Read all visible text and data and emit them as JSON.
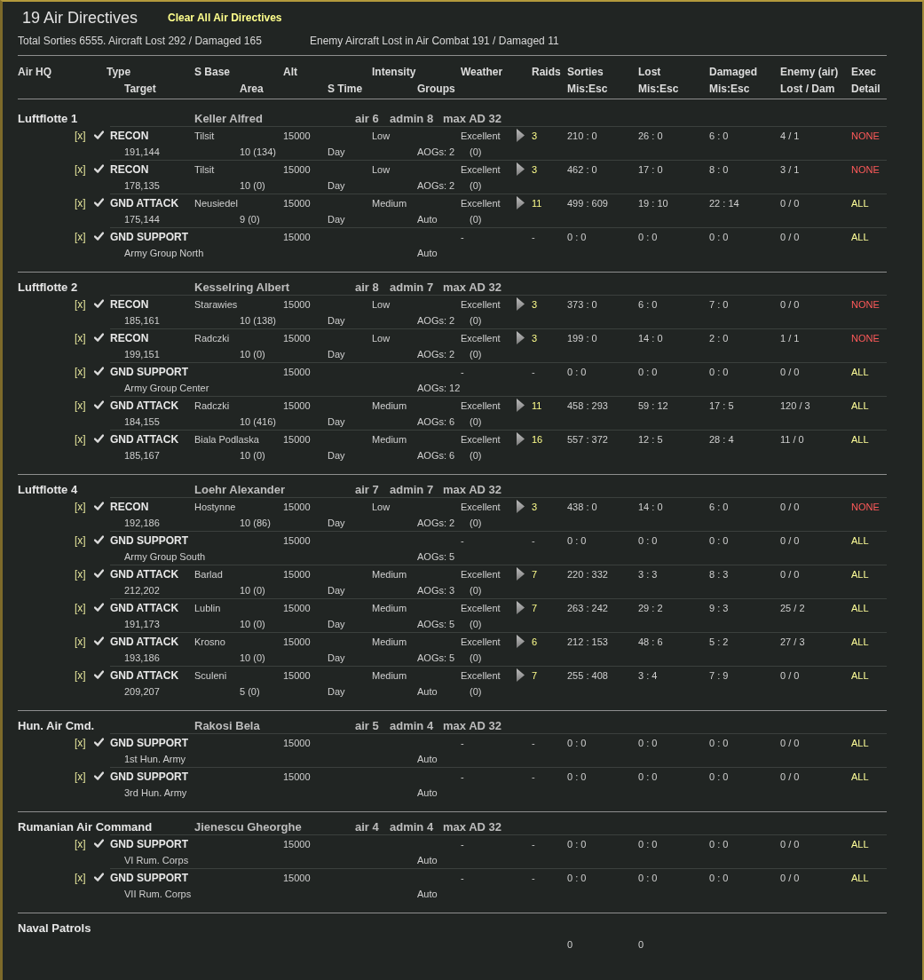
{
  "window": {
    "title": "19 Air Directives",
    "action": "Clear All Air Directives"
  },
  "summary": {
    "own": "Total Sorties 6555. Aircraft Lost 292 / Damaged 165",
    "enemy": "Enemy Aircraft Lost in Air Combat 191 / Damaged 11"
  },
  "table": {
    "header_top": [
      "Air HQ",
      "Type",
      "S Base",
      "Alt",
      "Intensity",
      "Weather",
      "Raids",
      "Sorties",
      "Lost",
      "Damaged",
      "Enemy (air)",
      "Exec"
    ],
    "header_bottom": [
      "Target",
      "Area",
      "S Time",
      "Groups",
      "Mis:Esc",
      "Mis:Esc",
      "Mis:Esc",
      "Lost / Dam",
      "Detail"
    ],
    "groups": [
      {
        "name": "Luftflotte 1",
        "commander": "Keller Alfred",
        "air": "air 6",
        "admin": "admin 8",
        "max_ad": "max AD 32",
        "directives": [
          {
            "delete": "[x]",
            "checked": true,
            "type": "RECON",
            "base": "Tilsit",
            "alt": "15000",
            "intensity": "Low",
            "weather": "Excellent",
            "expandable": true,
            "raids": "3",
            "sorties": "210 : 0",
            "lost": "26 : 0",
            "damaged": "6 : 0",
            "enemy": "4 / 1",
            "exec": {
              "text": "NONE",
              "color": "#ff5a5a"
            },
            "target": "191,144",
            "area": "10 (134)",
            "time": "Day",
            "groups": "AOGs: 2",
            "note": "(0)"
          },
          {
            "delete": "[x]",
            "checked": true,
            "type": "RECON",
            "base": "Tilsit",
            "alt": "15000",
            "intensity": "Low",
            "weather": "Excellent",
            "expandable": true,
            "raids": "3",
            "sorties": "462 : 0",
            "lost": "17 : 0",
            "damaged": "8 : 0",
            "enemy": "3 / 1",
            "exec": {
              "text": "NONE",
              "color": "#ff5a5a"
            },
            "target": "178,135",
            "area": "10 (0)",
            "time": "Day",
            "groups": "AOGs: 2",
            "note": "(0)"
          },
          {
            "delete": "[x]",
            "checked": true,
            "type": "GND ATTACK",
            "base": "Neusiedel",
            "alt": "15000",
            "intensity": "Medium",
            "weather": "Excellent",
            "expandable": true,
            "raids": "11",
            "sorties": "499 : 609",
            "lost": "19 : 10",
            "damaged": "22 : 14",
            "enemy": "0 / 0",
            "exec": {
              "text": "ALL",
              "color": "#ffff99"
            },
            "target": "175,144",
            "area": "9 (0)",
            "time": "Day",
            "groups": "Auto",
            "note": "(0)"
          },
          {
            "delete": "[x]",
            "checked": true,
            "type": "GND SUPPORT",
            "alt": "15000",
            "weather": "-",
            "expandable": false,
            "raids": "-",
            "sorties": "0 : 0",
            "lost": "0 : 0",
            "damaged": "0 : 0",
            "enemy": "0 / 0",
            "exec": {
              "text": "ALL",
              "color": "#ffff99"
            },
            "target": "Army Group North",
            "groups": "Auto"
          }
        ]
      },
      {
        "name": "Luftflotte 2",
        "commander": "Kesselring Albert",
        "air": "air 8",
        "admin": "admin 7",
        "max_ad": "max AD 32",
        "directives": [
          {
            "delete": "[x]",
            "checked": true,
            "type": "RECON",
            "base": "Starawies",
            "alt": "15000",
            "intensity": "Low",
            "weather": "Excellent",
            "expandable": true,
            "raids": "3",
            "sorties": "373 : 0",
            "lost": "6 : 0",
            "damaged": "7 : 0",
            "enemy": "0 / 0",
            "exec": {
              "text": "NONE",
              "color": "#ff5a5a"
            },
            "target": "185,161",
            "area": "10 (138)",
            "time": "Day",
            "groups": "AOGs: 2",
            "note": "(0)"
          },
          {
            "delete": "[x]",
            "checked": true,
            "type": "RECON",
            "base": "Radczki",
            "alt": "15000",
            "intensity": "Low",
            "weather": "Excellent",
            "expandable": true,
            "raids": "3",
            "sorties": "199 : 0",
            "lost": "14 : 0",
            "damaged": "2 : 0",
            "enemy": "1 / 1",
            "exec": {
              "text": "NONE",
              "color": "#ff5a5a"
            },
            "target": "199,151",
            "area": "10 (0)",
            "time": "Day",
            "groups": "AOGs: 2",
            "note": "(0)"
          },
          {
            "delete": "[x]",
            "checked": true,
            "type": "GND SUPPORT",
            "alt": "15000",
            "weather": "-",
            "expandable": false,
            "raids": "-",
            "sorties": "0 : 0",
            "lost": "0 : 0",
            "damaged": "0 : 0",
            "enemy": "0 / 0",
            "exec": {
              "text": "ALL",
              "color": "#ffff99"
            },
            "target": "Army Group Center",
            "groups": "AOGs: 12"
          },
          {
            "delete": "[x]",
            "checked": true,
            "type": "GND ATTACK",
            "base": "Radczki",
            "alt": "15000",
            "intensity": "Medium",
            "weather": "Excellent",
            "expandable": true,
            "raids": "11",
            "sorties": "458 : 293",
            "lost": "59 : 12",
            "damaged": "17 : 5",
            "enemy": "120 / 3",
            "exec": {
              "text": "ALL",
              "color": "#ffff99"
            },
            "target": "184,155",
            "area": "10 (416)",
            "time": "Day",
            "groups": "AOGs: 6",
            "note": "(0)"
          },
          {
            "delete": "[x]",
            "checked": true,
            "type": "GND ATTACK",
            "base": "Biala Podlaska",
            "alt": "15000",
            "intensity": "Medium",
            "weather": "Excellent",
            "expandable": true,
            "raids": "16",
            "sorties": "557 : 372",
            "lost": "12 : 5",
            "damaged": "28 : 4",
            "enemy": "11 / 0",
            "exec": {
              "text": "ALL",
              "color": "#ffff99"
            },
            "target": "185,167",
            "area": "10 (0)",
            "time": "Day",
            "groups": "AOGs: 6",
            "note": "(0)"
          }
        ]
      },
      {
        "name": "Luftflotte 4",
        "commander": "Loehr Alexander",
        "air": "air 7",
        "admin": "admin 7",
        "max_ad": "max AD 32",
        "directives": [
          {
            "delete": "[x]",
            "checked": true,
            "type": "RECON",
            "base": "Hostynne",
            "alt": "15000",
            "intensity": "Low",
            "weather": "Excellent",
            "expandable": true,
            "raids": "3",
            "sorties": "438 : 0",
            "lost": "14 : 0",
            "damaged": "6 : 0",
            "enemy": "0 / 0",
            "exec": {
              "text": "NONE",
              "color": "#ff5a5a"
            },
            "target": "192,186",
            "area": "10 (86)",
            "time": "Day",
            "groups": "AOGs: 2",
            "note": "(0)"
          },
          {
            "delete": "[x]",
            "checked": true,
            "type": "GND SUPPORT",
            "alt": "15000",
            "weather": "-",
            "expandable": false,
            "raids": "-",
            "sorties": "0 : 0",
            "lost": "0 : 0",
            "damaged": "0 : 0",
            "enemy": "0 / 0",
            "exec": {
              "text": "ALL",
              "color": "#ffff99"
            },
            "target": "Army Group South",
            "groups": "AOGs: 5"
          },
          {
            "delete": "[x]",
            "checked": true,
            "type": "GND ATTACK",
            "base": "Barlad",
            "alt": "15000",
            "intensity": "Medium",
            "weather": "Excellent",
            "expandable": true,
            "raids": "7",
            "sorties": "220 : 332",
            "lost": "3 : 3",
            "damaged": "8 : 3",
            "enemy": "0 / 0",
            "exec": {
              "text": "ALL",
              "color": "#ffff99"
            },
            "target": "212,202",
            "area": "10 (0)",
            "time": "Day",
            "groups": "AOGs: 3",
            "note": "(0)"
          },
          {
            "delete": "[x]",
            "checked": true,
            "type": "GND ATTACK",
            "base": "Lublin",
            "alt": "15000",
            "intensity": "Medium",
            "weather": "Excellent",
            "expandable": true,
            "raids": "7",
            "sorties": "263 : 242",
            "lost": "29 : 2",
            "damaged": "9 : 3",
            "enemy": "25 / 2",
            "exec": {
              "text": "ALL",
              "color": "#ffff99"
            },
            "target": "191,173",
            "area": "10 (0)",
            "time": "Day",
            "groups": "AOGs: 5",
            "note": "(0)"
          },
          {
            "delete": "[x]",
            "checked": true,
            "type": "GND ATTACK",
            "base": "Krosno",
            "alt": "15000",
            "intensity": "Medium",
            "weather": "Excellent",
            "expandable": true,
            "raids": "6",
            "sorties": "212 : 153",
            "lost": "48 : 6",
            "damaged": "5 : 2",
            "enemy": "27 / 3",
            "exec": {
              "text": "ALL",
              "color": "#ffff99"
            },
            "target": "193,186",
            "area": "10 (0)",
            "time": "Day",
            "groups": "AOGs: 5",
            "note": "(0)"
          },
          {
            "delete": "[x]",
            "checked": true,
            "type": "GND ATTACK",
            "base": "Sculeni",
            "alt": "15000",
            "intensity": "Medium",
            "weather": "Excellent",
            "expandable": true,
            "raids": "7",
            "sorties": "255 : 408",
            "lost": "3 : 4",
            "damaged": "7 : 9",
            "enemy": "0 / 0",
            "exec": {
              "text": "ALL",
              "color": "#ffff99"
            },
            "target": "209,207",
            "area": "5 (0)",
            "time": "Day",
            "groups": "Auto",
            "note": "(0)"
          }
        ]
      },
      {
        "name": "Hun. Air Cmd.",
        "commander": "Rakosi Bela",
        "air": "air 5",
        "admin": "admin 4",
        "max_ad": "max AD 32",
        "directives": [
          {
            "delete": "[x]",
            "checked": true,
            "type": "GND SUPPORT",
            "alt": "15000",
            "weather": "-",
            "expandable": false,
            "raids": "-",
            "sorties": "0 : 0",
            "lost": "0 : 0",
            "damaged": "0 : 0",
            "enemy": "0 / 0",
            "exec": {
              "text": "ALL",
              "color": "#ffff99"
            },
            "target": "1st Hun. Army",
            "groups": "Auto"
          },
          {
            "delete": "[x]",
            "checked": true,
            "type": "GND SUPPORT",
            "alt": "15000",
            "weather": "-",
            "expandable": false,
            "raids": "-",
            "sorties": "0 : 0",
            "lost": "0 : 0",
            "damaged": "0 : 0",
            "enemy": "0 / 0",
            "exec": {
              "text": "ALL",
              "color": "#ffff99"
            },
            "target": "3rd Hun. Army",
            "groups": "Auto"
          }
        ]
      },
      {
        "name": "Rumanian Air Command",
        "commander": "Jienescu Gheorghe",
        "air": "air 4",
        "admin": "admin 4",
        "max_ad": "max AD 32",
        "directives": [
          {
            "delete": "[x]",
            "checked": true,
            "type": "GND SUPPORT",
            "alt": "15000",
            "weather": "-",
            "expandable": false,
            "raids": "-",
            "sorties": "0 : 0",
            "lost": "0 : 0",
            "damaged": "0 : 0",
            "enemy": "0 / 0",
            "exec": {
              "text": "ALL",
              "color": "#ffff99"
            },
            "target": "VI Rum. Corps",
            "groups": "Auto"
          },
          {
            "delete": "[x]",
            "checked": true,
            "type": "GND SUPPORT",
            "alt": "15000",
            "weather": "-",
            "expandable": false,
            "raids": "-",
            "sorties": "0 : 0",
            "lost": "0 : 0",
            "damaged": "0 : 0",
            "enemy": "0 / 0",
            "exec": {
              "text": "ALL",
              "color": "#ffff99"
            },
            "target": "VII Rum. Corps",
            "groups": "Auto"
          }
        ]
      }
    ],
    "naval": {
      "name": "Naval Patrols",
      "sorties": "0",
      "lost": "0"
    }
  }
}
